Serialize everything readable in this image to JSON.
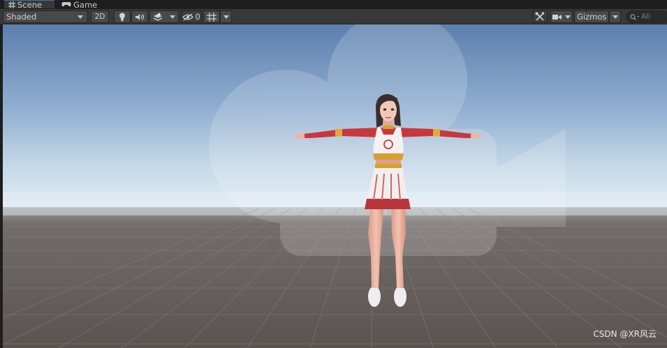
{
  "tabs": [
    {
      "label": "Scene",
      "icon": "grid-hash-icon",
      "active": true
    },
    {
      "label": "Game",
      "icon": "gamepad-icon",
      "active": false
    }
  ],
  "toolbar": {
    "draw_mode": "Shaded",
    "mode_2d": "2D",
    "hidden_count": "0",
    "gizmos": "Gizmos",
    "search_placeholder": "All"
  },
  "viewport": {
    "sky_color": "#5d7fae",
    "horizon_color": "#d8e6ef",
    "ground_color": "#595250"
  },
  "watermark": "CSDN @XR风云"
}
